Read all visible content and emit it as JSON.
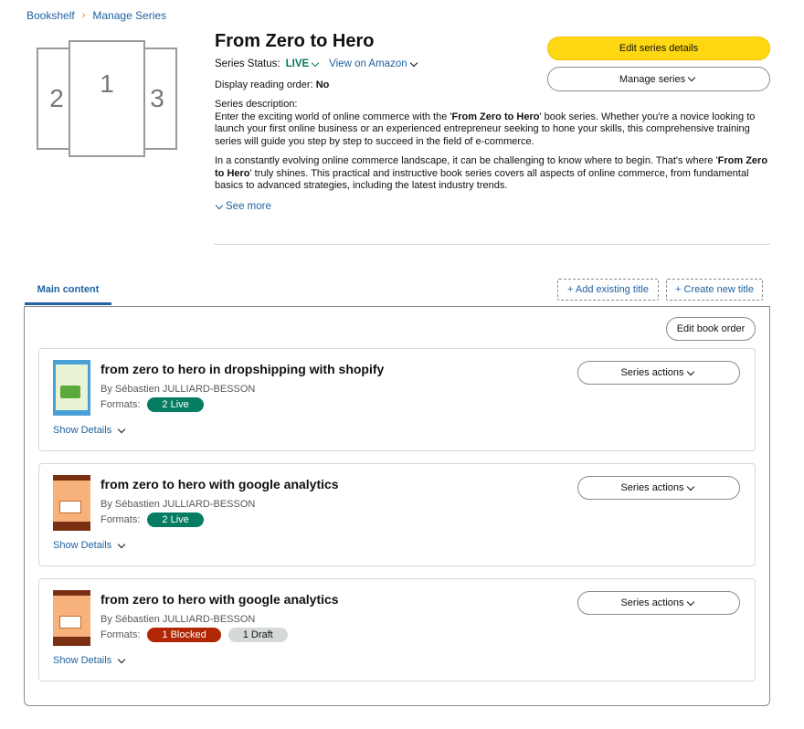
{
  "breadcrumb": {
    "bookshelf": "Bookshelf",
    "separator": "›",
    "manage_series": "Manage Series"
  },
  "thumbnail": {
    "card1": "1",
    "card2": "2",
    "card3": "3"
  },
  "series": {
    "title": "From Zero to Hero",
    "status_label": "Series Status:",
    "status_value": "LIVE",
    "view_on_amazon": "View on Amazon",
    "reading_order_label": "Display reading order:",
    "reading_order_value": "No",
    "description_label": "Series description:",
    "desc1_a": "Enter the exciting world of online commerce with the '",
    "desc1_bold": "From Zero to Hero",
    "desc1_b": "' book series. Whether you're a novice looking to launch your first online business or an experienced entrepreneur seeking to hone your skills, this comprehensive training series will guide you step by step to succeed in the field of e-commerce.",
    "desc2_a": "In a constantly evolving online commerce landscape, it can be challenging to know where to begin. That's where '",
    "desc2_bold": "From Zero to Hero",
    "desc2_b": "' truly shines. This practical and instructive book series covers all aspects of online commerce, from fundamental basics to advanced strategies, including the latest industry trends.",
    "see_more": "See more"
  },
  "buttons": {
    "edit_series_details": "Edit series details",
    "manage_series": "Manage series",
    "add_existing_title": "+ Add existing title",
    "create_new_title": "+ Create new title",
    "edit_book_order": "Edit book order"
  },
  "tabs": {
    "main_content": "Main content"
  },
  "books": [
    {
      "title": "from zero to hero in dropshipping with shopify",
      "author": "By Sébastien JULLIARD-BESSON",
      "formats_label": "Formats:",
      "pill1": "2 Live",
      "show_details": "Show Details",
      "series_actions": "Series actions"
    },
    {
      "title": "from zero to hero with google analytics",
      "author": "By Sébastien JULLIARD-BESSON",
      "formats_label": "Formats:",
      "pill1": "2 Live",
      "show_details": "Show Details",
      "series_actions": "Series actions"
    },
    {
      "title": "from zero to hero with google analytics",
      "author": "By Sébastien JULLIARD-BESSON",
      "formats_label": "Formats:",
      "pill1": "1 Blocked",
      "pill2": "1 Draft",
      "show_details": "Show Details",
      "series_actions": "Series actions"
    }
  ]
}
